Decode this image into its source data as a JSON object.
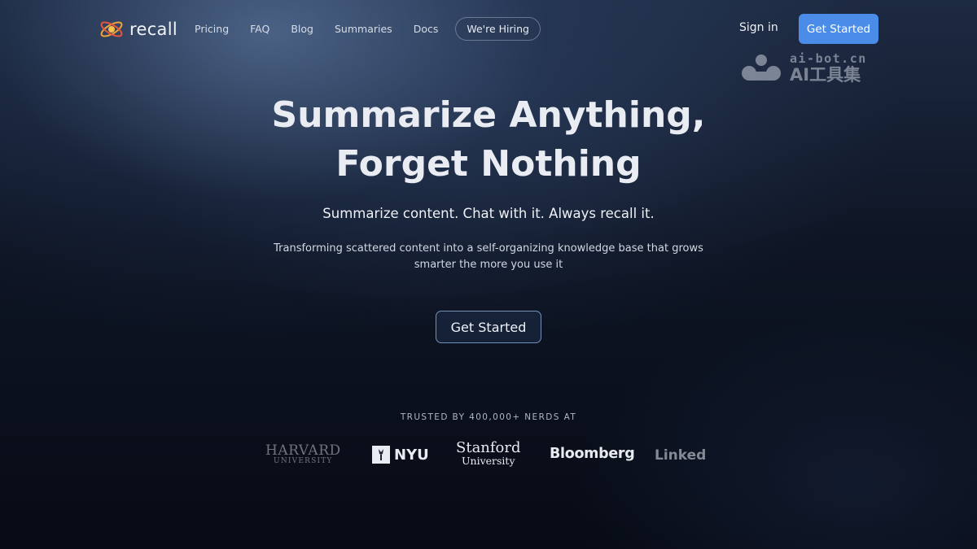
{
  "nav": {
    "brand": "recall",
    "links": [
      "Pricing",
      "FAQ",
      "Blog",
      "Summaries",
      "Docs"
    ],
    "hiring": "We're Hiring",
    "signin": "Sign in",
    "get_started": "Get Started"
  },
  "watermark": {
    "url": "ai-bot.cn",
    "name": "AI工具集"
  },
  "hero": {
    "title_line1": "Summarize Anything,",
    "title_line2": "Forget Nothing",
    "subtitle": "Summarize content. Chat with it. Always recall it.",
    "description": "Transforming scattered content into a self-organizing knowledge base that grows smarter the more you use it",
    "cta": "Get Started"
  },
  "trusted": {
    "heading": "TRUSTED BY 400,000+ NERDS AT",
    "logos": {
      "harvard": "HARVARD",
      "harvard_sub": "UNIVERSITY",
      "nyu": "NYU",
      "stanford": "Stanford",
      "stanford_sub": "University",
      "bloomberg": "Bloomberg",
      "linkedin": "Linked"
    }
  },
  "colors": {
    "accent": "#4a8ce8",
    "background": "#0b1120"
  }
}
